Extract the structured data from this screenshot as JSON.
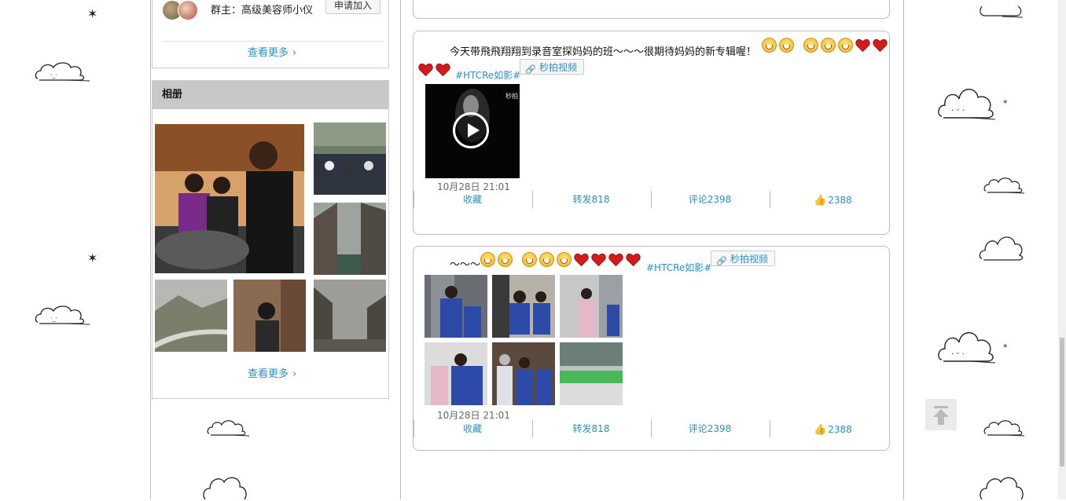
{
  "group": {
    "owner_text": "群主：高级美容师小仪",
    "apply_label": "申请加入",
    "see_more": "查看更多"
  },
  "album": {
    "title": "相册",
    "see_more": "查看更多"
  },
  "posts": [
    {
      "text": "今天带飛飛翔翔到录音室探妈妈的班～～～很期待妈妈的新专辑喔！",
      "topic": "#HTCRe如影#",
      "miaopai": "秒拍视频",
      "time": "10月28日 21:01",
      "collect": "收藏",
      "forward": "转发818",
      "comment": "评论2398",
      "likes": "2388"
    },
    {
      "text": "～～～",
      "topic": "#HTCRe如影#",
      "miaopai": "秒拍视频",
      "time": "10月28日 21:01",
      "collect": "收藏",
      "forward": "转发818",
      "comment": "评论2398",
      "likes": "2388"
    }
  ],
  "colors": {
    "link": "#2b8fc4",
    "accent": "#e8542d",
    "album_header": "#c8c8c8",
    "card_border": "#bdbdbd"
  },
  "icons": {
    "see_more_arrow": "chevron-right-icon",
    "play": "play-icon",
    "like": "thumbs-up-icon",
    "link": "link-icon",
    "back_to_top": "arrow-up-icon"
  }
}
